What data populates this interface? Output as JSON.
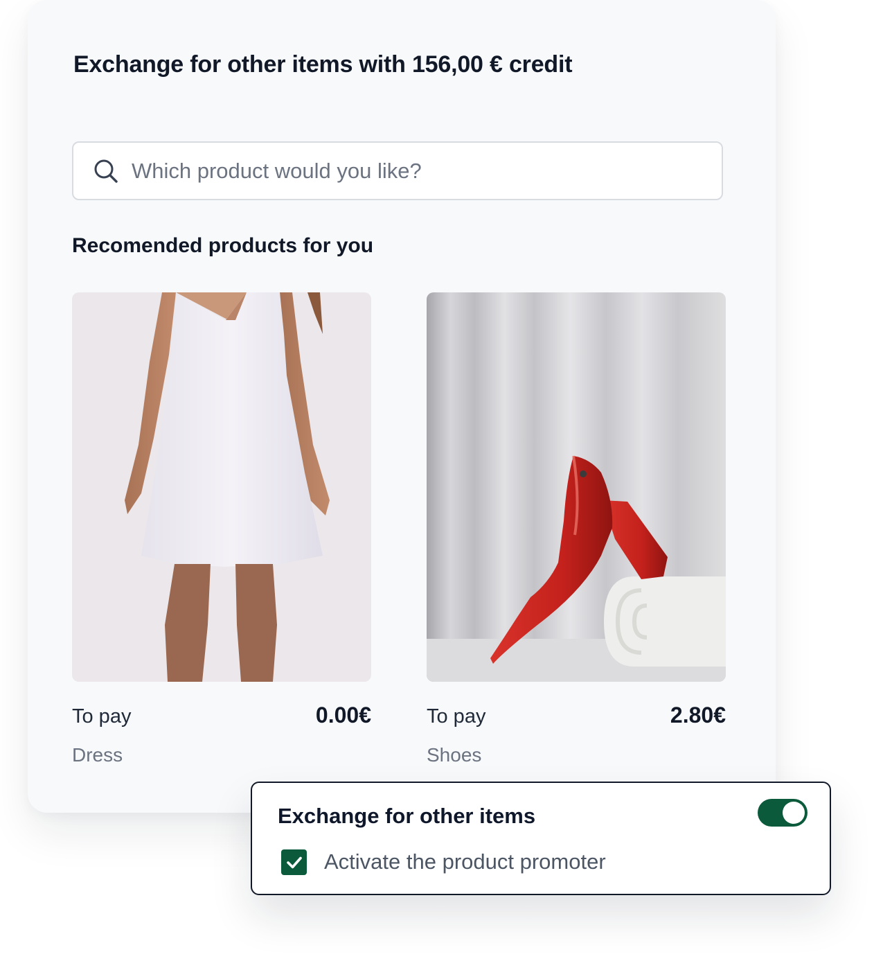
{
  "panel": {
    "title": "Exchange for other items with 156,00 € credit",
    "search": {
      "icon": "search-icon",
      "placeholder": "Which product would you like?",
      "value": ""
    },
    "section_title": "Recomended products for you",
    "products": [
      {
        "image": "white-dress-photo",
        "to_pay_label": "To pay",
        "price": "0.00€",
        "name": "Dress"
      },
      {
        "image": "red-heel-shoe-photo",
        "to_pay_label": "To pay",
        "price": "2.80€",
        "name": "Shoes"
      }
    ]
  },
  "popup": {
    "title": "Exchange for other items",
    "toggle": {
      "on": true
    },
    "checkbox": {
      "checked": true,
      "label": "Activate the product promoter"
    }
  },
  "colors": {
    "panel_bg": "#f8f9fb",
    "accent_green": "#0b5a3c",
    "text_dark": "#111827",
    "text_muted": "#6b7280",
    "input_border": "#d8dbe0"
  }
}
